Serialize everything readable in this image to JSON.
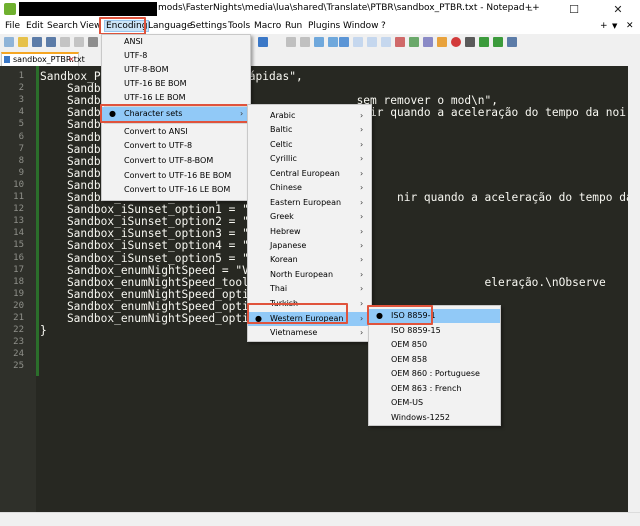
{
  "window": {
    "title": "mods\\FasterNights\\media\\lua\\shared\\Translate\\PTBR\\sandbox_PTBR.txt - Notepad++",
    "minimize": "–",
    "maximize": "☐",
    "close": "✕"
  },
  "menubar": [
    "File",
    "Edit",
    "Search",
    "View",
    "Encoding",
    "Language",
    "Settings",
    "Tools",
    "Macro",
    "Run",
    "Plugins",
    "Window",
    "?"
  ],
  "menubar_extra": {
    "plus": "+",
    "down": "▼",
    "close": "✕"
  },
  "tab": {
    "label": "sandbox_PTBR.txt",
    "close": "✕"
  },
  "editor": {
    "lines": [
      {
        "n": "1",
        "text": "Sandbox_P                  es Rápidas\","
      },
      {
        "n": "2",
        "text": "    Sandbo                  \","
      },
      {
        "n": "3",
        "text": "    Sandbo                                     sem remover o mod\\n\","
      },
      {
        "n": "4",
        "text": "    Sandbo                                      nir quando a aceleração do tempo da noi"
      },
      {
        "n": "5",
        "text": "    Sandbo"
      },
      {
        "n": "6",
        "text": "    Sandbo"
      },
      {
        "n": "7",
        "text": "    Sandbo"
      },
      {
        "n": "8",
        "text": "    Sandbo"
      },
      {
        "n": "9",
        "text": "    Sandbox_iSunrise_option5 = "
      },
      {
        "n": "10",
        "text": "    Sandbox_iSunset = \"Final do"
      },
      {
        "n": "11",
        "text": "    Sandbox_iSunset_tooltip = \"E                     nir quando a aceleração do tempo da noit"
      },
      {
        "n": "12",
        "text": "    Sandbox_iSunset_option1 = \"1"
      },
      {
        "n": "13",
        "text": "    Sandbox_iSunset_option2 = \"2"
      },
      {
        "n": "14",
        "text": "    Sandbox_iSunset_option3 = \"2"
      },
      {
        "n": "15",
        "text": "    Sandbox_iSunset_option4 = \"2"
      },
      {
        "n": "16",
        "text": "    Sandbox_iSunset_option5 = \"2"
      },
      {
        "n": "17",
        "text": "    Sandbox_enumNightSpeed = \"Ve"
      },
      {
        "n": "18",
        "text": "    Sandbox_enumNightSpeed_toolt                                  eleração.\\nObserve"
      },
      {
        "n": "19",
        "text": "    Sandbox_enumNightSpeed_optio"
      },
      {
        "n": "20",
        "text": "    Sandbox_enumNightSpeed_optio"
      },
      {
        "n": "21",
        "text": "    Sandbox_enumNightSpeed_option3 = \"Instantâneo\""
      },
      {
        "n": "22",
        "text": "}"
      },
      {
        "n": "23",
        "text": ""
      },
      {
        "n": "24",
        "text": ""
      },
      {
        "n": "25",
        "text": ""
      }
    ]
  },
  "encoding_menu": {
    "items": [
      {
        "label": "ANSI"
      },
      {
        "label": "UTF-8"
      },
      {
        "label": "UTF-8-BOM"
      },
      {
        "label": "UTF-16 BE BOM"
      },
      {
        "label": "UTF-16 LE BOM"
      },
      {
        "label": "Character sets",
        "selected": true,
        "submenu": true
      },
      {
        "label": "Convert to ANSI"
      },
      {
        "label": "Convert to UTF-8"
      },
      {
        "label": "Convert to UTF-8-BOM"
      },
      {
        "label": "Convert to UTF-16 BE BOM"
      },
      {
        "label": "Convert to UTF-16 LE BOM"
      }
    ]
  },
  "charset_menu": {
    "items": [
      "Arabic",
      "Baltic",
      "Celtic",
      "Cyrillic",
      "Central European",
      "Chinese",
      "Eastern European",
      "Greek",
      "Hebrew",
      "Japanese",
      "Korean",
      "North European",
      "Thai",
      "Turkish",
      "Western European",
      "Vietnamese"
    ],
    "selected": "Western European"
  },
  "western_menu": {
    "items": [
      "ISO 8859-1",
      "ISO 8859-15",
      "OEM 850",
      "OEM 858",
      "OEM 860 : Portuguese",
      "OEM 863 : French",
      "OEM-US",
      "Windows-1252"
    ],
    "selected": "ISO 8859-1"
  },
  "glyphs": {
    "bullet": "●",
    "arrow": "›"
  },
  "colors": {
    "highlight": "#91c9f7",
    "annotation": "#e0533c",
    "editor_bg": "#272822"
  }
}
